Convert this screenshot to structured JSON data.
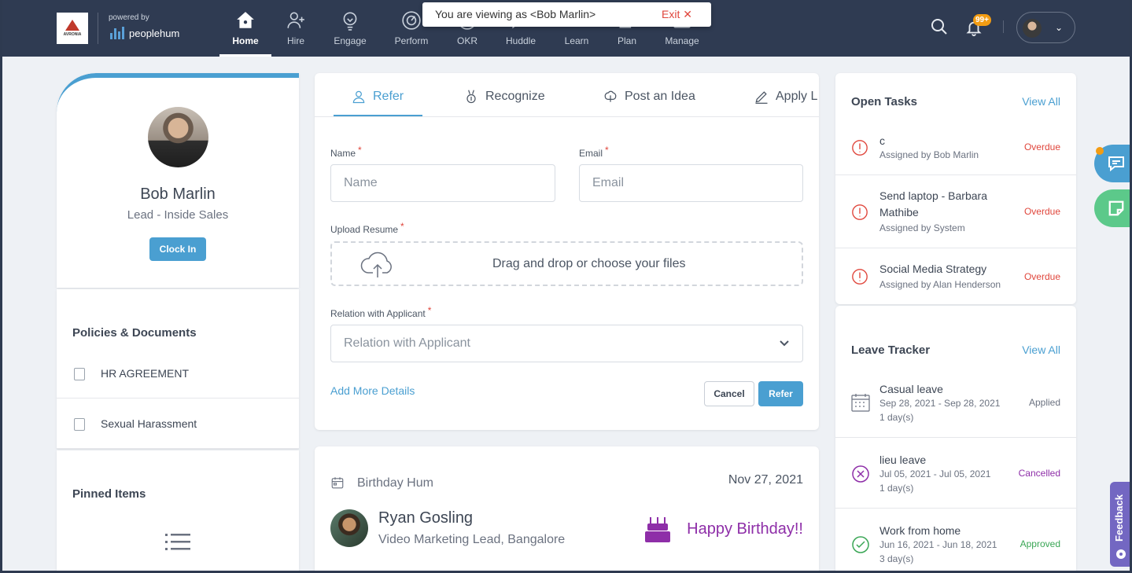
{
  "brand": {
    "logo_text": "AVRONIA",
    "powered_by": "powered by",
    "product": "peoplehum"
  },
  "nav": [
    {
      "label": "Home",
      "icon": "home-icon",
      "active": true
    },
    {
      "label": "Hire",
      "icon": "add-user-icon"
    },
    {
      "label": "Engage",
      "icon": "bulb-icon"
    },
    {
      "label": "Perform",
      "icon": "gauge-icon"
    },
    {
      "label": "OKR",
      "icon": "target-icon"
    },
    {
      "label": "Huddle",
      "icon": "chat-icon"
    },
    {
      "label": "Learn",
      "icon": "graduation-icon"
    },
    {
      "label": "Plan",
      "icon": "plan-icon"
    },
    {
      "label": "Manage",
      "icon": "briefcase-icon"
    }
  ],
  "viewing_banner": {
    "text": "You are viewing as <Bob Marlin>",
    "exit_label": "Exit"
  },
  "notifications": {
    "count": "99+"
  },
  "profile": {
    "name": "Bob Marlin",
    "role": "Lead - Inside Sales",
    "clock_in_label": "Clock In"
  },
  "policies": {
    "title": "Policies & Documents",
    "items": [
      {
        "label": "HR AGREEMENT"
      },
      {
        "label": "Sexual Harassment"
      }
    ]
  },
  "pinned": {
    "title": "Pinned Items"
  },
  "refer_form": {
    "tabs": [
      {
        "label": "Refer",
        "icon": "user-icon"
      },
      {
        "label": "Recognize",
        "icon": "medal-icon"
      },
      {
        "label": "Post an Idea",
        "icon": "brain-icon"
      },
      {
        "label": "Apply L",
        "icon": "pen-icon"
      }
    ],
    "name_label": "Name",
    "name_placeholder": "Name",
    "email_label": "Email",
    "email_placeholder": "Email",
    "upload_label": "Upload Resume",
    "upload_text": "Drag and drop or choose your files",
    "relation_label": "Relation with Applicant",
    "relation_placeholder": "Relation with Applicant",
    "add_more": "Add More Details",
    "cancel_label": "Cancel",
    "refer_label": "Refer"
  },
  "birthday": {
    "title": "Birthday Hum",
    "date": "Nov 27, 2021",
    "name": "Ryan Gosling",
    "role": "Video Marketing Lead, Bangalore",
    "message": "Happy Birthday!!"
  },
  "open_tasks": {
    "title": "Open Tasks",
    "view_all": "View All",
    "items": [
      {
        "title": "c",
        "assigned": "Assigned by Bob Marlin",
        "status": "Overdue"
      },
      {
        "title": "Send laptop - Barbara Mathibe",
        "assigned": "Assigned by System",
        "status": "Overdue"
      },
      {
        "title": "Social Media Strategy",
        "assigned": "Assigned by Alan Henderson",
        "status": "Overdue"
      }
    ]
  },
  "leave_tracker": {
    "title": "Leave Tracker",
    "view_all": "View All",
    "items": [
      {
        "type": "Casual leave",
        "dates": "Sep 28, 2021 - Sep 28, 2021",
        "days": "1 day(s)",
        "status": "Applied"
      },
      {
        "type": "lieu leave",
        "dates": "Jul 05, 2021 - Jul 05, 2021",
        "days": "1 day(s)",
        "status": "Cancelled"
      },
      {
        "type": "Work from home",
        "dates": "Jun 16, 2021 - Jun 18, 2021",
        "days": "3 day(s)",
        "status": "Approved"
      }
    ]
  },
  "feedback": {
    "label": "Feedback"
  },
  "colors": {
    "accent": "#4a9fd1",
    "overdue": "#e0463c",
    "cancelled": "#8e2ea8",
    "approved": "#3aa655",
    "nav_bg": "#2f3b52"
  }
}
